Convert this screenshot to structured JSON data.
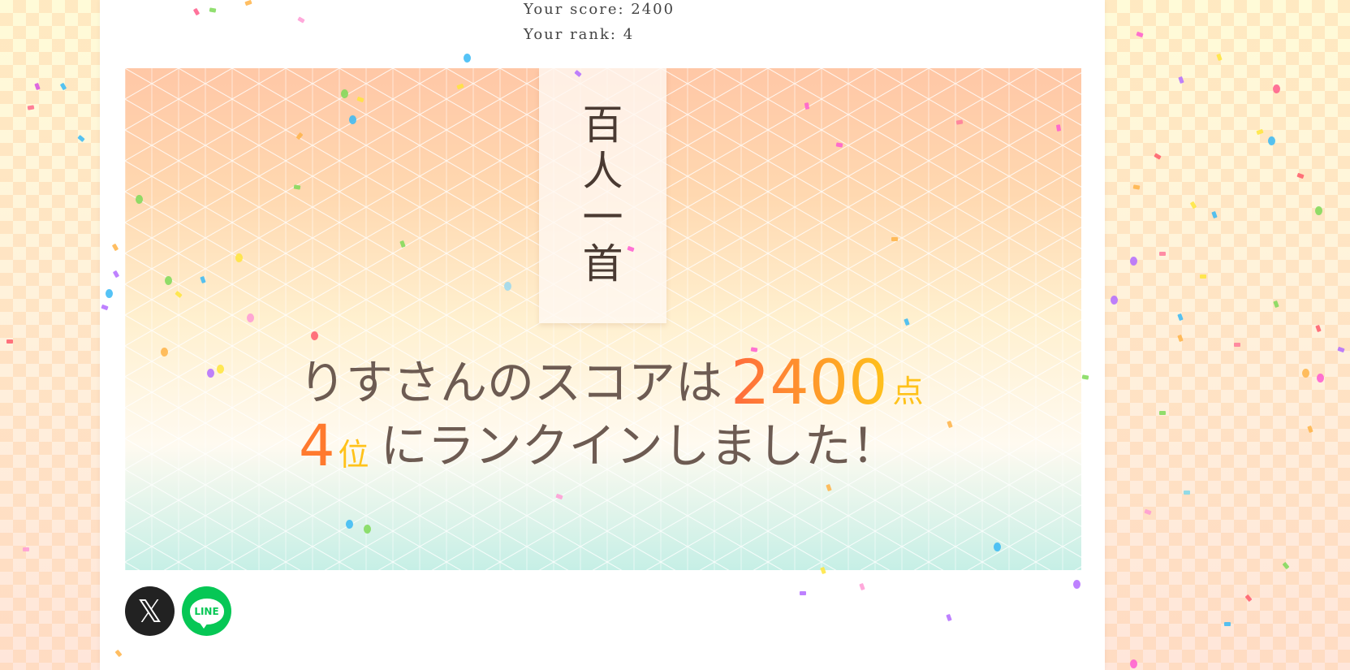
{
  "score_info": {
    "score_line": "Your score: 2400",
    "rank_line": "Your rank: 4"
  },
  "banner": {
    "title_chars": [
      "百",
      "人",
      "一",
      "首"
    ],
    "message_line1_text": "りすさんのスコアは",
    "score_value": "2400",
    "score_unit": "点",
    "rank_value": "4",
    "rank_unit": "位",
    "message_line2_text": "にランクインしました！"
  },
  "share": {
    "x_icon": "x-logo-icon",
    "line_icon": "line-logo-icon",
    "line_label": "LINE"
  },
  "colors": {
    "score_gradient_start": "#ff6a3d",
    "score_gradient_end": "#ffc21a",
    "text_brown": "#6d5b52",
    "line_green": "#06c755",
    "x_black": "#222222"
  }
}
